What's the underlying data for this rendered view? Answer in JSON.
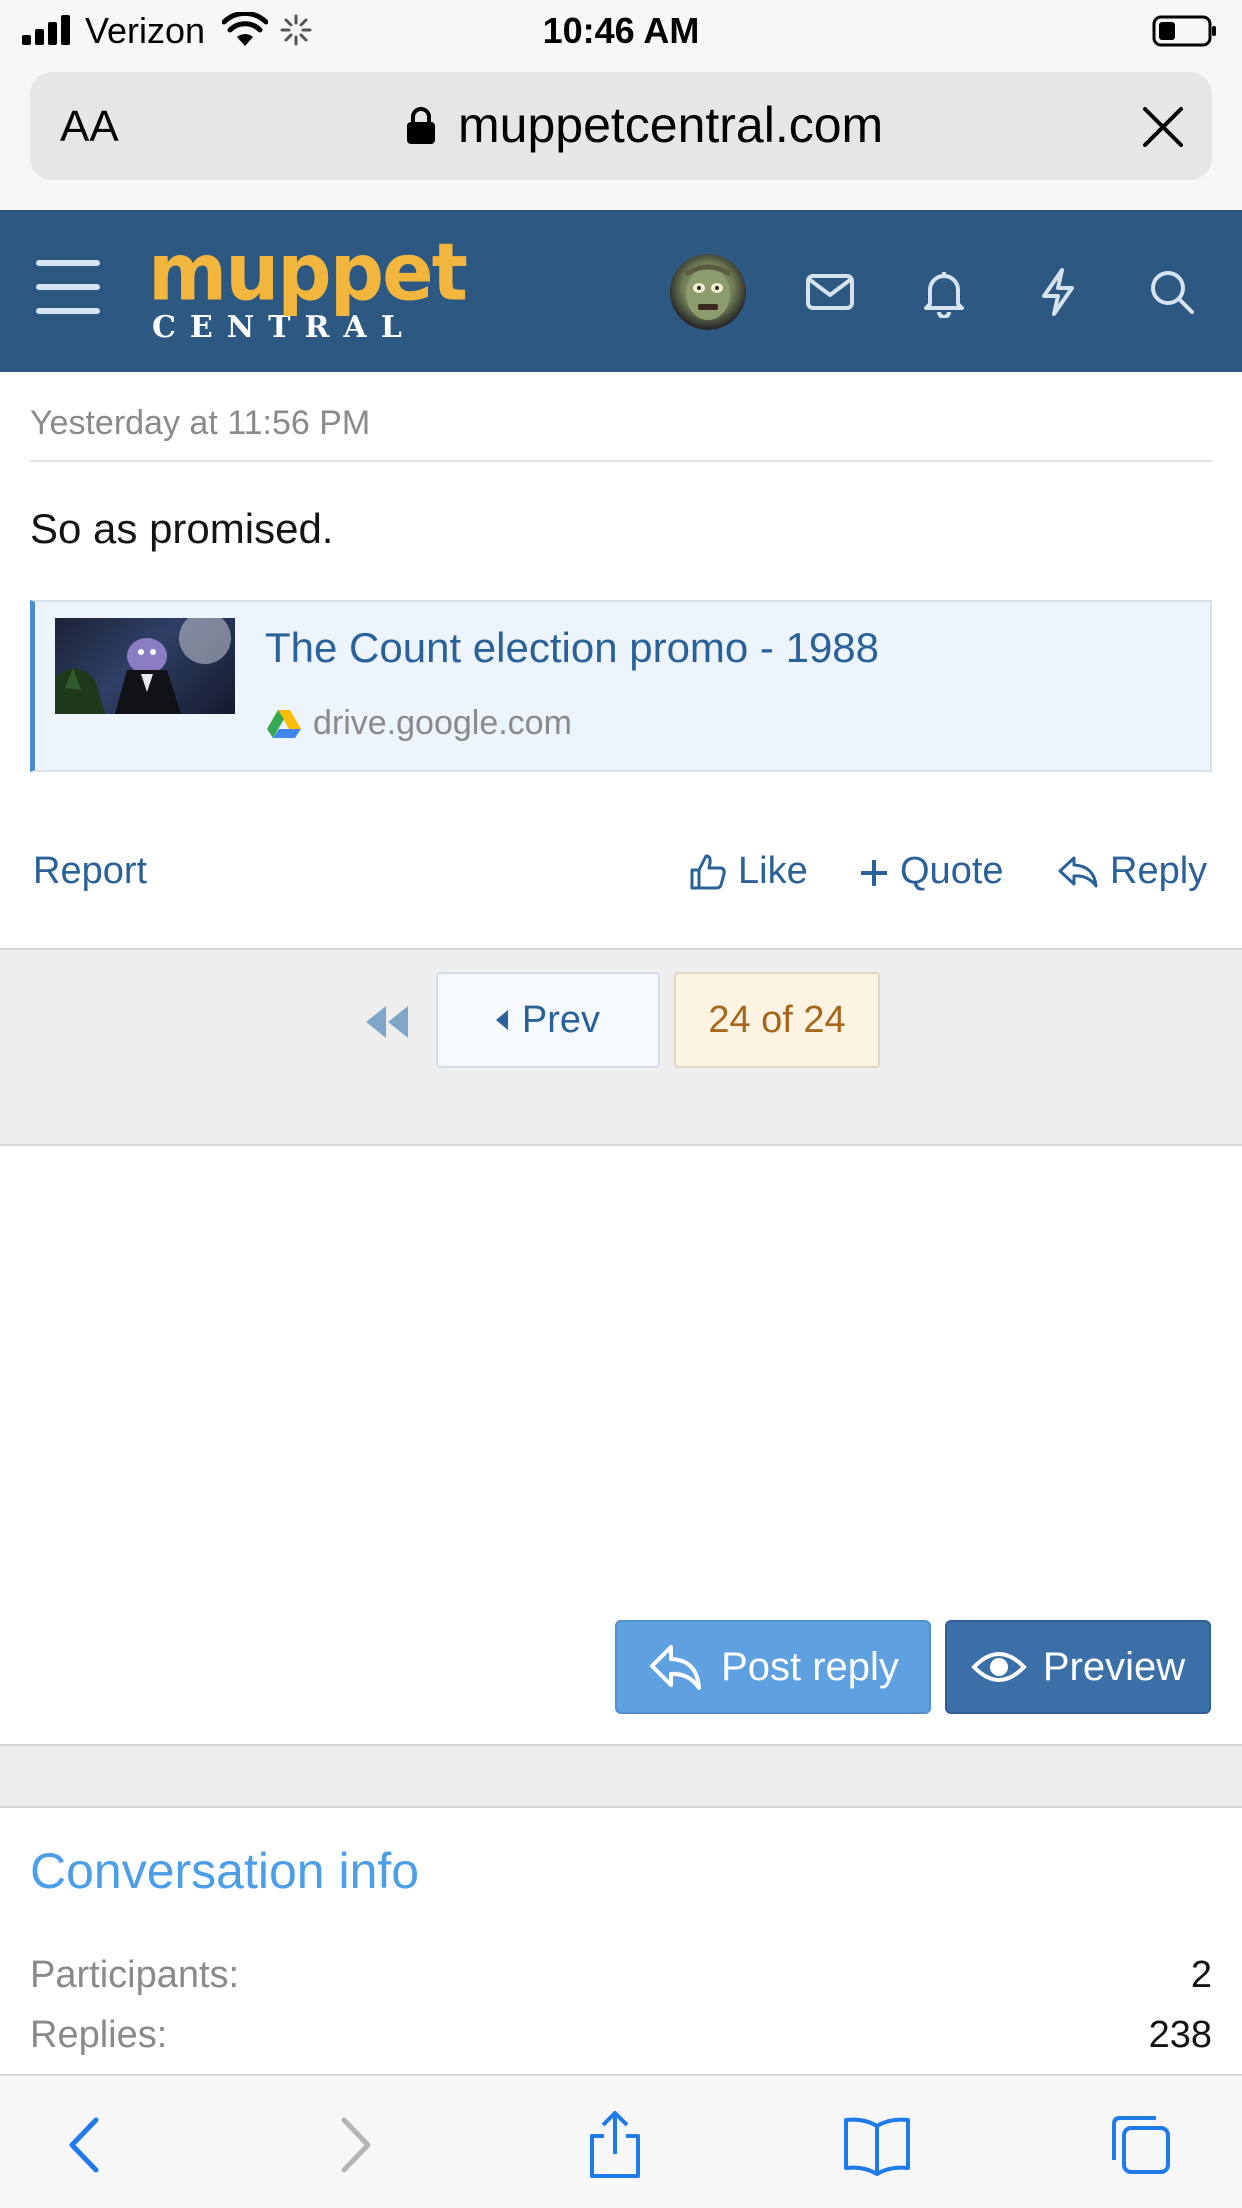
{
  "status_bar": {
    "carrier": "Verizon",
    "time": "10:46 AM"
  },
  "url_bar": {
    "text_size_label": "AA",
    "domain": "muppetcentral.com"
  },
  "site": {
    "logo_top": "muppet",
    "logo_bottom": "CENTRAL",
    "brand_color": "#2c5882",
    "logo_color": "#f2b53d"
  },
  "post": {
    "timestamp": "Yesterday at 11:56 PM",
    "body": "So as promised.",
    "embed": {
      "title": "The Count election promo - 1988",
      "domain": "drive.google.com"
    },
    "actions": {
      "report": "Report",
      "like": "Like",
      "quote": "Quote",
      "reply": "Reply"
    }
  },
  "pagination": {
    "prev": "Prev",
    "current": "24 of 24"
  },
  "reply_buttons": {
    "post_reply": "Post reply",
    "preview": "Preview"
  },
  "conversation_info": {
    "title": "Conversation info",
    "rows": [
      {
        "label": "Participants:",
        "value": "2"
      },
      {
        "label": "Replies:",
        "value": "238"
      }
    ]
  },
  "icons": {
    "header": [
      "menu-icon",
      "avatar",
      "mail-icon",
      "bell-icon",
      "bolt-icon",
      "search-icon"
    ],
    "toolbar": [
      "back-icon",
      "forward-icon",
      "share-icon",
      "bookmarks-icon",
      "tabs-icon"
    ]
  }
}
